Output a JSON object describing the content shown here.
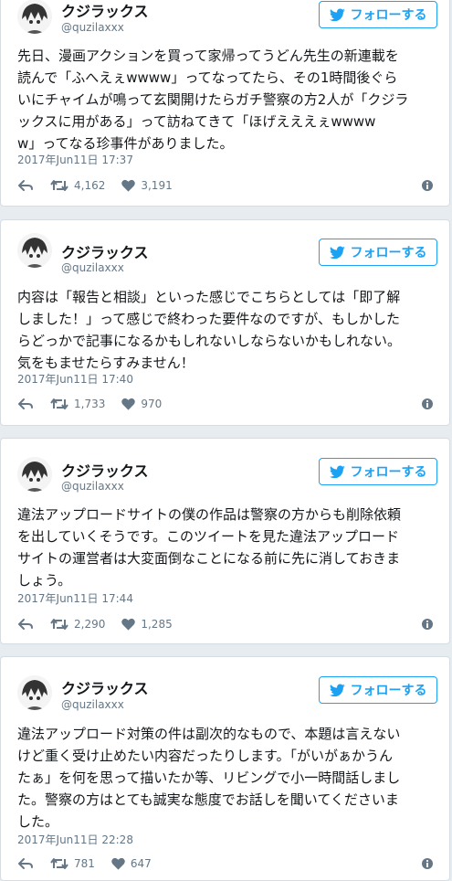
{
  "follow_label": "フォローする",
  "tweets": [
    {
      "name": "クジラックス",
      "handle": "@quzilaxxx",
      "text": "先日、漫画アクションを買って家帰ってうどん先生の新連載を\n読んで「ふへえぇwwww」ってなってたら、その1時間後ぐら\nいにチャイムが鳴って玄関開けたらガチ警察の方2人が「クジラ\nックスに用がある」って訪ねてきて「ほげえええぇwwww\nw」ってなる珍事件がありました。",
      "time": "2017年Jun11日 17:37",
      "retweets": "4,162",
      "likes": "3,191"
    },
    {
      "name": "クジラックス",
      "handle": "@quzilaxxx",
      "text": "内容は「報告と相談」といった感じでこちらとしては「即了解\nしました！」って感じで終わった要件なのですが、もしかした\nらどっかで記事になるかもしれないしならないかもしれない。\n気をもませたらすみません！",
      "time": "2017年Jun11日 17:40",
      "retweets": "1,733",
      "likes": "970"
    },
    {
      "name": "クジラックス",
      "handle": "@quzilaxxx",
      "text": "違法アップロードサイトの僕の作品は警察の方からも削除依頼\nを出していくそうです。このツイートを見た違法アップロード\nサイトの運営者は大変面倒なことになる前に先に消しておきま\nしょう。",
      "time": "2017年Jun11日 17:44",
      "retweets": "2,290",
      "likes": "1,285"
    },
    {
      "name": "クジラックス",
      "handle": "@quzilaxxx",
      "text": "違法アップロード対策の件は副次的なもので、本題は言えない\nけど重く受け止めたい内容だったりします。「がいがぁかうん\nたぁ」を何を思って描いたか等、リビングで小一時間話しまし\nた。警察の方はとても誠実な態度でお話しを聞いてくださいま\nした。",
      "time": "2017年Jun11日 22:28",
      "retweets": "781",
      "likes": "647"
    }
  ]
}
